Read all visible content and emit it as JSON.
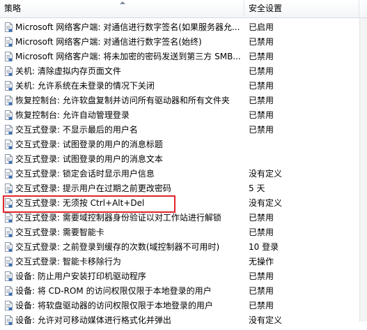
{
  "header": {
    "policy": "策略",
    "setting": "安全设置"
  },
  "rows": [
    {
      "name": "Microsoft 网络客户端: 对通信进行数字签名(如果服务器允...",
      "value": "已启用"
    },
    {
      "name": "Microsoft 网络客户端: 对通信进行数字签名(始终)",
      "value": "已禁用"
    },
    {
      "name": "Microsoft 网络客户端: 将未加密的密码发送到第三方 SMB...",
      "value": "已禁用"
    },
    {
      "name": "关机: 清除虚拟内存页面文件",
      "value": "已禁用"
    },
    {
      "name": "关机: 允许系统在未登录的情况下关闭",
      "value": "已禁用"
    },
    {
      "name": "恢复控制台: 允许软盘复制并访问所有驱动器和所有文件夹",
      "value": "已禁用"
    },
    {
      "name": "恢复控制台: 允许自动管理登录",
      "value": "已禁用"
    },
    {
      "name": "交互式登录: 不显示最后的用户名",
      "value": "已禁用"
    },
    {
      "name": "交互式登录: 试图登录的用户的消息标题",
      "value": ""
    },
    {
      "name": "交互式登录: 试图登录的用户的消息文本",
      "value": ""
    },
    {
      "name": "交互式登录: 锁定会话时显示用户信息",
      "value": "没有定义"
    },
    {
      "name": "交互式登录: 提示用户在过期之前更改密码",
      "value": "5 天"
    },
    {
      "name": "交互式登录: 无须按 Ctrl+Alt+Del",
      "value": "没有定义"
    },
    {
      "name": "交互式登录: 需要域控制器身份验证以对工作站进行解锁",
      "value": "已禁用"
    },
    {
      "name": "交互式登录: 需要智能卡",
      "value": "已禁用"
    },
    {
      "name": "交互式登录: 之前登录到缓存的次数(域控制器不可用时)",
      "value": "10 登录"
    },
    {
      "name": "交互式登录: 智能卡移除行为",
      "value": "无操作"
    },
    {
      "name": "设备: 防止用户安装打印机驱动程序",
      "value": "已禁用"
    },
    {
      "name": "设备: 将 CD-ROM 的访问权限仅限于本地登录的用户",
      "value": "已禁用"
    },
    {
      "name": "设备: 将软盘驱动器的访问权限仅限于本地登录的用户",
      "value": "已禁用"
    },
    {
      "name": "设备: 允许对可移动媒体进行格式化并弹出",
      "value": "没有定义"
    }
  ],
  "colors": {
    "highlight": "#e0252b",
    "icon_blue": "#3c6fb5"
  },
  "icons": {
    "row": "policy-document-icon"
  }
}
